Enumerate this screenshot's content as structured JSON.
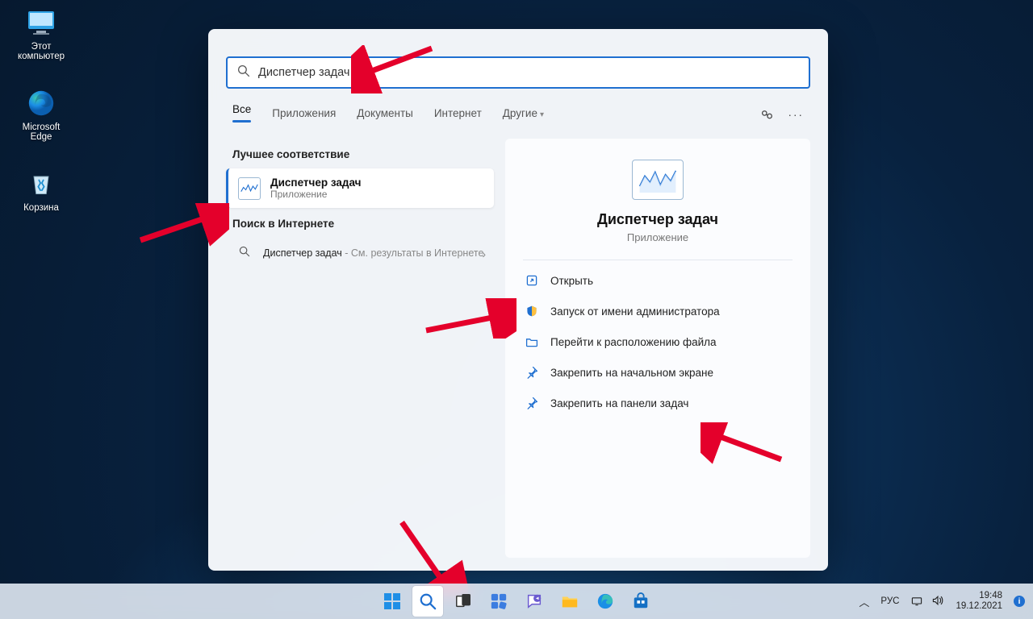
{
  "desktop": {
    "icons": {
      "this_pc": "Этот\nкомпьютер",
      "edge": "Microsoft\nEdge",
      "recycle": "Корзина"
    }
  },
  "search": {
    "query": "Диспетчер задач",
    "tabs": {
      "all": "Все",
      "apps": "Приложения",
      "documents": "Документы",
      "web": "Интернет",
      "more": "Другие"
    },
    "best_match_label": "Лучшее соответствие",
    "result": {
      "title": "Диспетчер задач",
      "subtitle": "Приложение"
    },
    "internet_section_label": "Поиск в Интернете",
    "internet_result": {
      "prefix": "Диспетчер задач",
      "suffix": " - См. результаты в Интернете"
    },
    "details": {
      "title": "Диспетчер задач",
      "subtitle": "Приложение",
      "actions": {
        "open": "Открыть",
        "run_admin": "Запуск от имени администратора",
        "open_location": "Перейти к расположению файла",
        "pin_start": "Закрепить на начальном экране",
        "pin_taskbar": "Закрепить на панели задач"
      }
    }
  },
  "taskbar": {
    "lang": "РУС",
    "time": "19:48",
    "date": "19.12.2021"
  }
}
